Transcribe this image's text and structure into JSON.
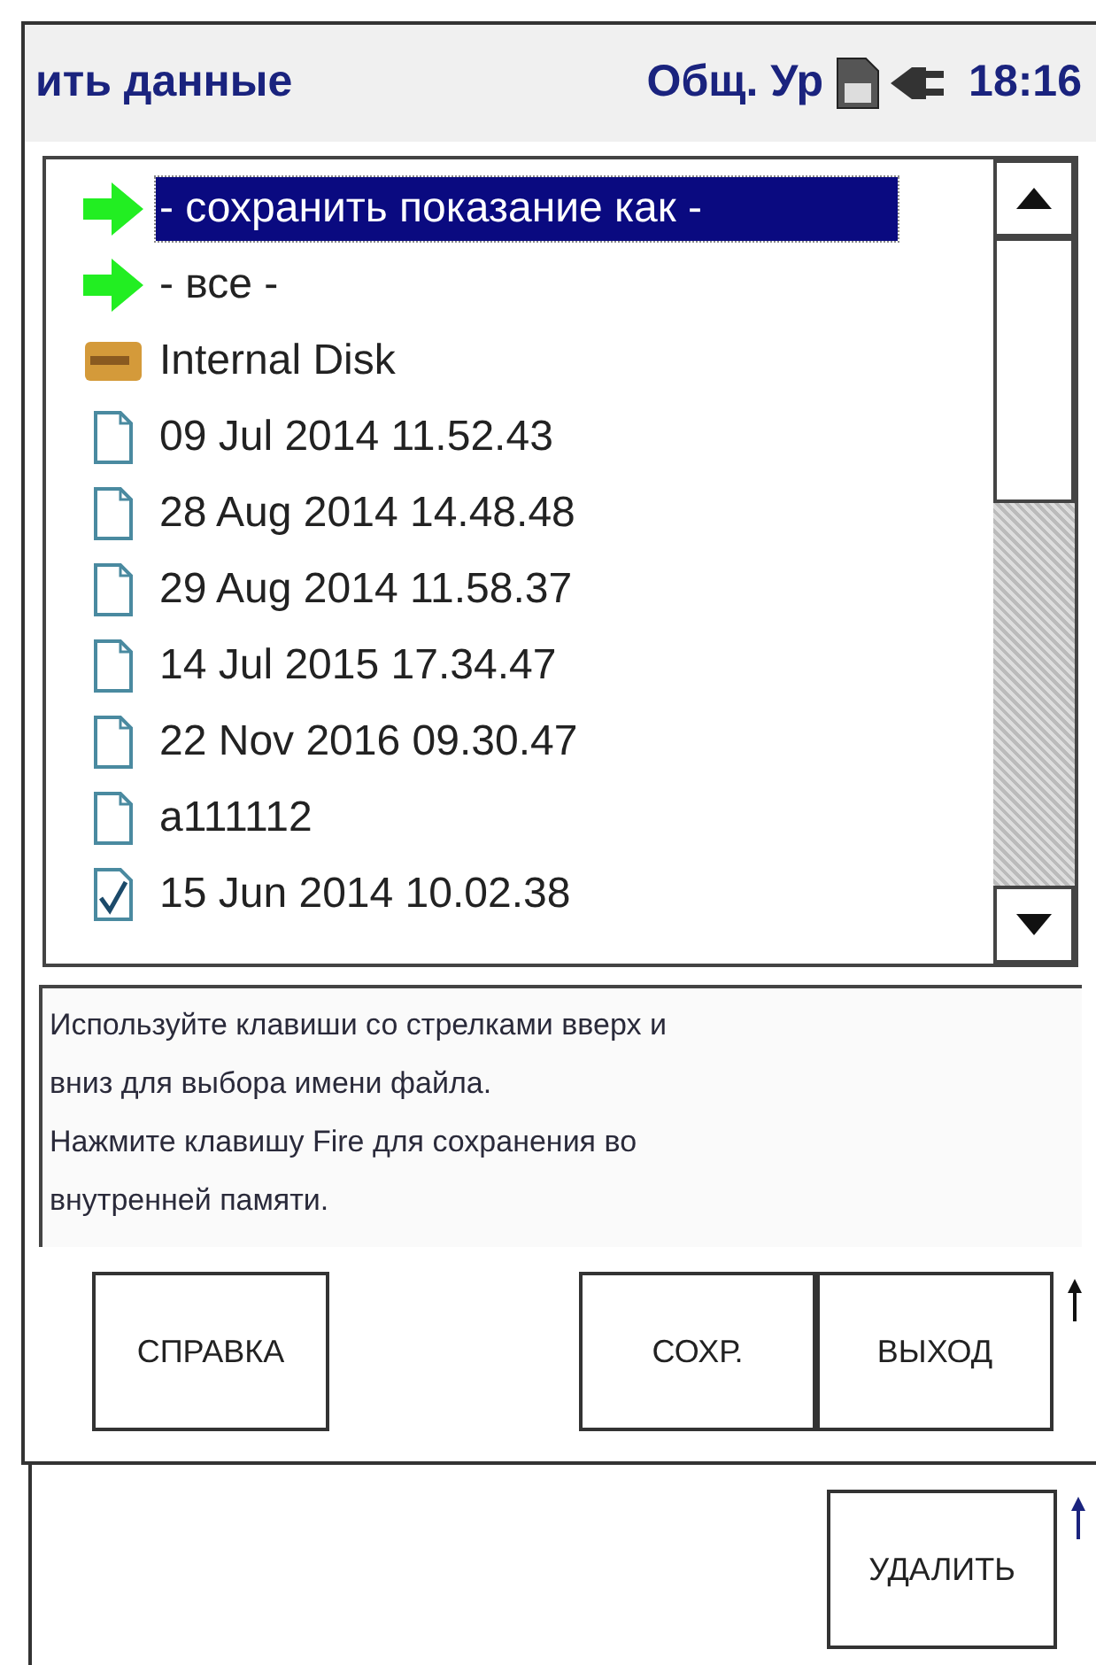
{
  "header": {
    "title": "ить данные",
    "profile": "Общ. Ур",
    "time": "18:16"
  },
  "files": [
    {
      "kind": "arrow",
      "label": "- сохранить показание как -",
      "selected": true
    },
    {
      "kind": "arrow",
      "label": "- все -",
      "selected": false
    },
    {
      "kind": "folder",
      "label": "Internal Disk",
      "selected": false
    },
    {
      "kind": "file",
      "label": "09 Jul 2014 11.52.43",
      "selected": false
    },
    {
      "kind": "file",
      "label": "28 Aug 2014 14.48.48",
      "selected": false
    },
    {
      "kind": "file",
      "label": "29 Aug 2014 11.58.37",
      "selected": false
    },
    {
      "kind": "file",
      "label": "14 Jul 2015 17.34.47",
      "selected": false
    },
    {
      "kind": "file",
      "label": "22 Nov 2016 09.30.47",
      "selected": false
    },
    {
      "kind": "file",
      "label": "a111112",
      "selected": false
    },
    {
      "kind": "checked-file",
      "label": "15 Jun 2014 10.02.38",
      "selected": false
    }
  ],
  "help_text": "Используйте клавиши со стрелками вверх и\nвниз для выбора имени файла.\nНажмите клавишу Fire для сохранения во\nвнутренней памяти.",
  "buttons": [
    "СПРАВКА",
    "СОХР.",
    "ВЫХОД"
  ],
  "second_buttons": [
    "УДАЛИТЬ"
  ]
}
